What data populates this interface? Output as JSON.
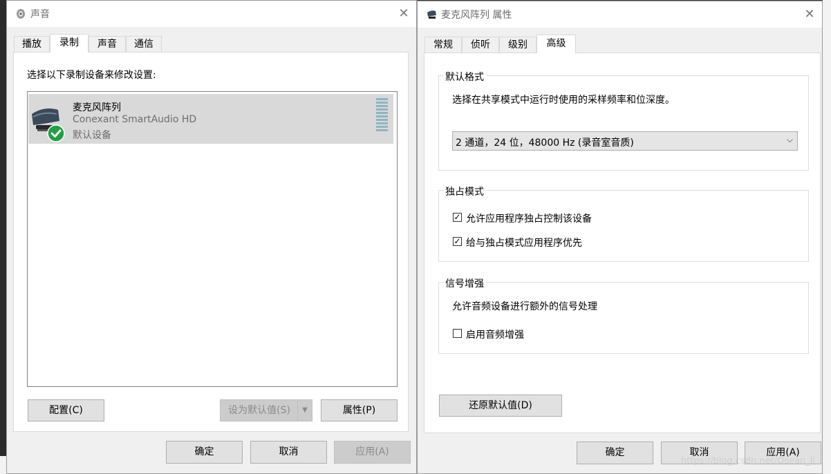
{
  "sound_window": {
    "title": "声音",
    "tabs": [
      "播放",
      "录制",
      "声音",
      "通信"
    ],
    "active_tab": "录制",
    "instruction": "选择以下录制设备来修改设置:",
    "device": {
      "name": "麦克风阵列",
      "driver": "Conexant SmartAudio HD",
      "status": "默认设备"
    },
    "buttons": {
      "configure": "配置(C)",
      "set_default": "设为默认值(S)",
      "properties": "属性(P)",
      "ok": "确定",
      "cancel": "取消",
      "apply": "应用(A)"
    }
  },
  "props_window": {
    "title": "麦克风阵列 属性",
    "tabs": [
      "常规",
      "侦听",
      "级别",
      "高级"
    ],
    "active_tab": "高级",
    "default_format": {
      "legend": "默认格式",
      "description": "选择在共享模式中运行时使用的采样频率和位深度。",
      "selected": "2 通道，24 位，48000 Hz (录音室音质)"
    },
    "exclusive_mode": {
      "legend": "独占模式",
      "allow_exclusive": {
        "label": "允许应用程序独占控制该设备",
        "checked": true
      },
      "give_priority": {
        "label": "给与独占模式应用程序优先",
        "checked": true
      }
    },
    "signal_enhancement": {
      "legend": "信号增强",
      "description": "允许音频设备进行额外的信号处理",
      "enable": {
        "label": "启用音频增强",
        "checked": false
      }
    },
    "buttons": {
      "restore_defaults": "还原默认值(D)",
      "ok": "确定",
      "cancel": "取消",
      "apply": "应用(A)"
    }
  },
  "watermark": "https://blog.csdn.net/Osean_li",
  "colors": {
    "selected_row": "#d9d9d9",
    "check_green": "#1e9f44",
    "level_meter": "#8fb4c4"
  }
}
